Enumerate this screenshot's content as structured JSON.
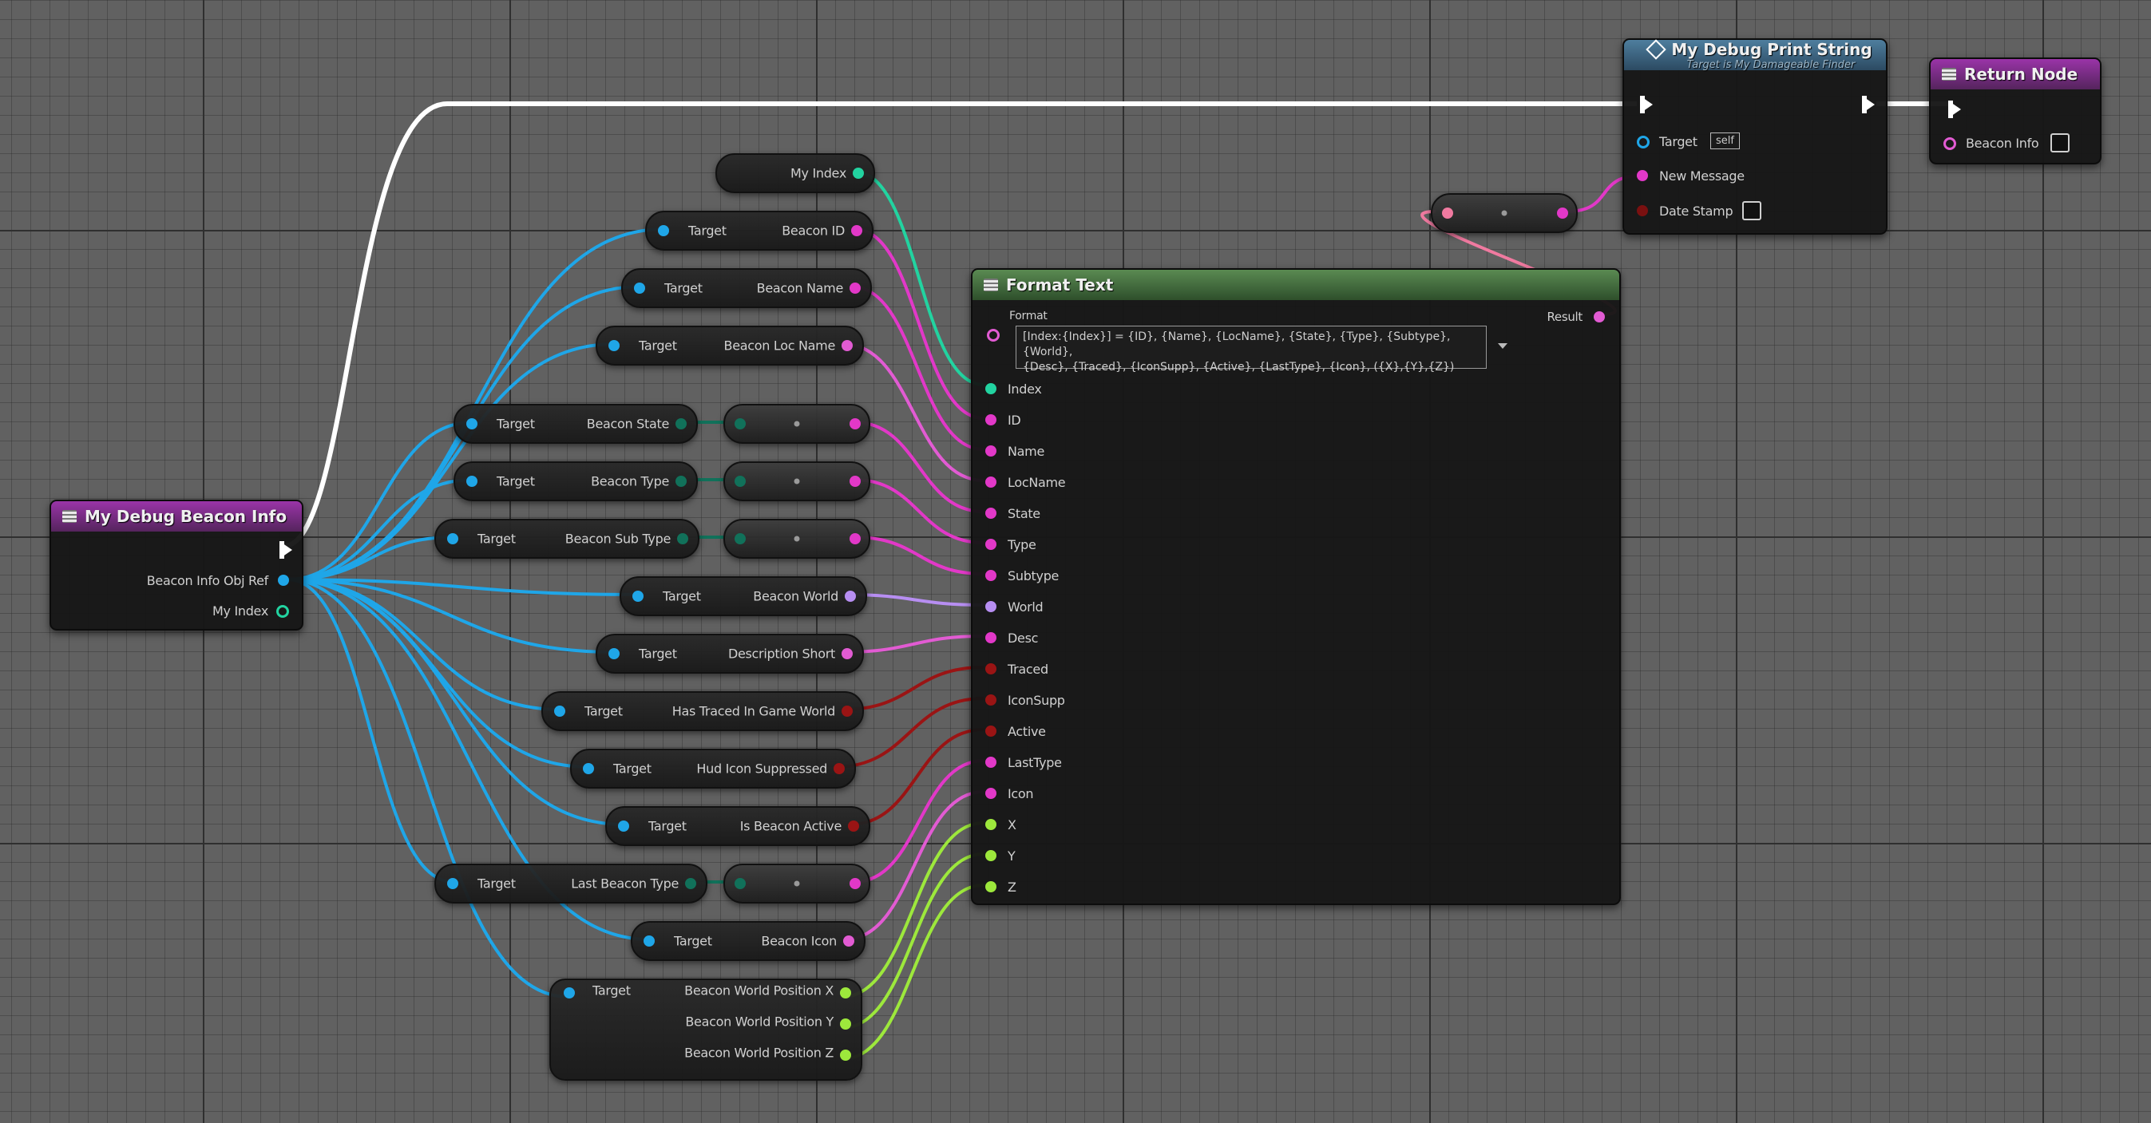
{
  "debug_beacon_info": {
    "title": "My Debug Beacon Info",
    "out_pins": [
      "Beacon Info Obj Ref",
      "My Index"
    ]
  },
  "print_string": {
    "title": "My Debug Print String",
    "subtitle": "Target is My Damageable Finder",
    "pins": [
      "Target",
      "New Message",
      "Date Stamp"
    ],
    "target_value": "self"
  },
  "return_node": {
    "title": "Return Node",
    "pins": [
      "Beacon Info"
    ]
  },
  "format_text": {
    "title": "Format Text",
    "format_label": "Format",
    "format_value_line1": "[Index:{Index}] = {ID}, {Name}, {LocName}, {State}, {Type}, {Subtype}, {World},",
    "format_value_line2": "{Desc}, {Traced}, {IconSupp}, {Active}, {LastType}, {Icon}, ({X},{Y},{Z})",
    "result_label": "Result",
    "pins": [
      "Index",
      "ID",
      "Name",
      "LocName",
      "State",
      "Type",
      "Subtype",
      "World",
      "Desc",
      "Traced",
      "IconSupp",
      "Active",
      "LastType",
      "Icon",
      "X",
      "Y",
      "Z"
    ]
  },
  "getters": {
    "my_index": "My Index",
    "target": "Target",
    "beacon_id": "Beacon ID",
    "beacon_name": "Beacon Name",
    "beacon_loc_name": "Beacon Loc Name",
    "beacon_state": "Beacon State",
    "beacon_type": "Beacon Type",
    "beacon_sub_type": "Beacon Sub Type",
    "beacon_world": "Beacon World",
    "description_short": "Description Short",
    "has_traced": "Has Traced In Game World",
    "hud_icon": "Hud Icon Suppressed",
    "is_active": "Is Beacon Active",
    "last_type": "Last Beacon Type",
    "beacon_icon": "Beacon Icon",
    "pos_x": "Beacon World Position X",
    "pos_y": "Beacon World Position Y",
    "pos_z": "Beacon World Position Z"
  },
  "colors": {
    "exec": "#ffffff",
    "object": "#1fa6e8",
    "int": "#22d3a0",
    "string": "#e238c8",
    "text": "#e25bd3",
    "bool": "#9a1414",
    "struct": "#b78ef2",
    "float": "#9de83c",
    "byte": "#11715a"
  }
}
